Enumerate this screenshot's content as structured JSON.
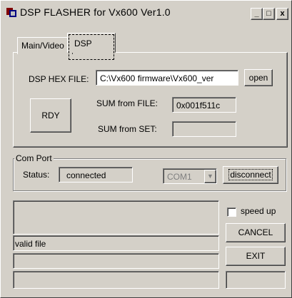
{
  "window": {
    "title": "DSP FLASHER for Vx600  Ver1.0",
    "minimize": "_",
    "maximize": "□",
    "close": "x"
  },
  "tabs": [
    {
      "label": "Main/Video"
    },
    {
      "label": "DSP"
    }
  ],
  "dsp": {
    "hex_label": "DSP HEX FILE:",
    "hex_value": "C:\\Vx600 firmware\\Vx600_ver",
    "open_label": "open",
    "rdy_label": "RDY",
    "sum_file_label": "SUM from FILE:",
    "sum_file_value": "0x001f511c",
    "sum_set_label": "SUM from SET:",
    "sum_set_value": ""
  },
  "com": {
    "group_label": "Com Port",
    "status_label": "Status:",
    "status_value": "connected",
    "port_value": "COM1",
    "disconnect_label": "disconnect"
  },
  "log": {
    "line1": "",
    "line2": "valid file",
    "line3": "",
    "line4": ""
  },
  "side": {
    "speed_up_label": "speed up",
    "speed_up_checked": false,
    "cancel_label": "CANCEL",
    "exit_label": "EXIT",
    "progress_value": ""
  },
  "colors": {
    "face": "#d4d0c8",
    "shadow": "#808080",
    "dark": "#404040",
    "highlight": "#ffffff"
  }
}
